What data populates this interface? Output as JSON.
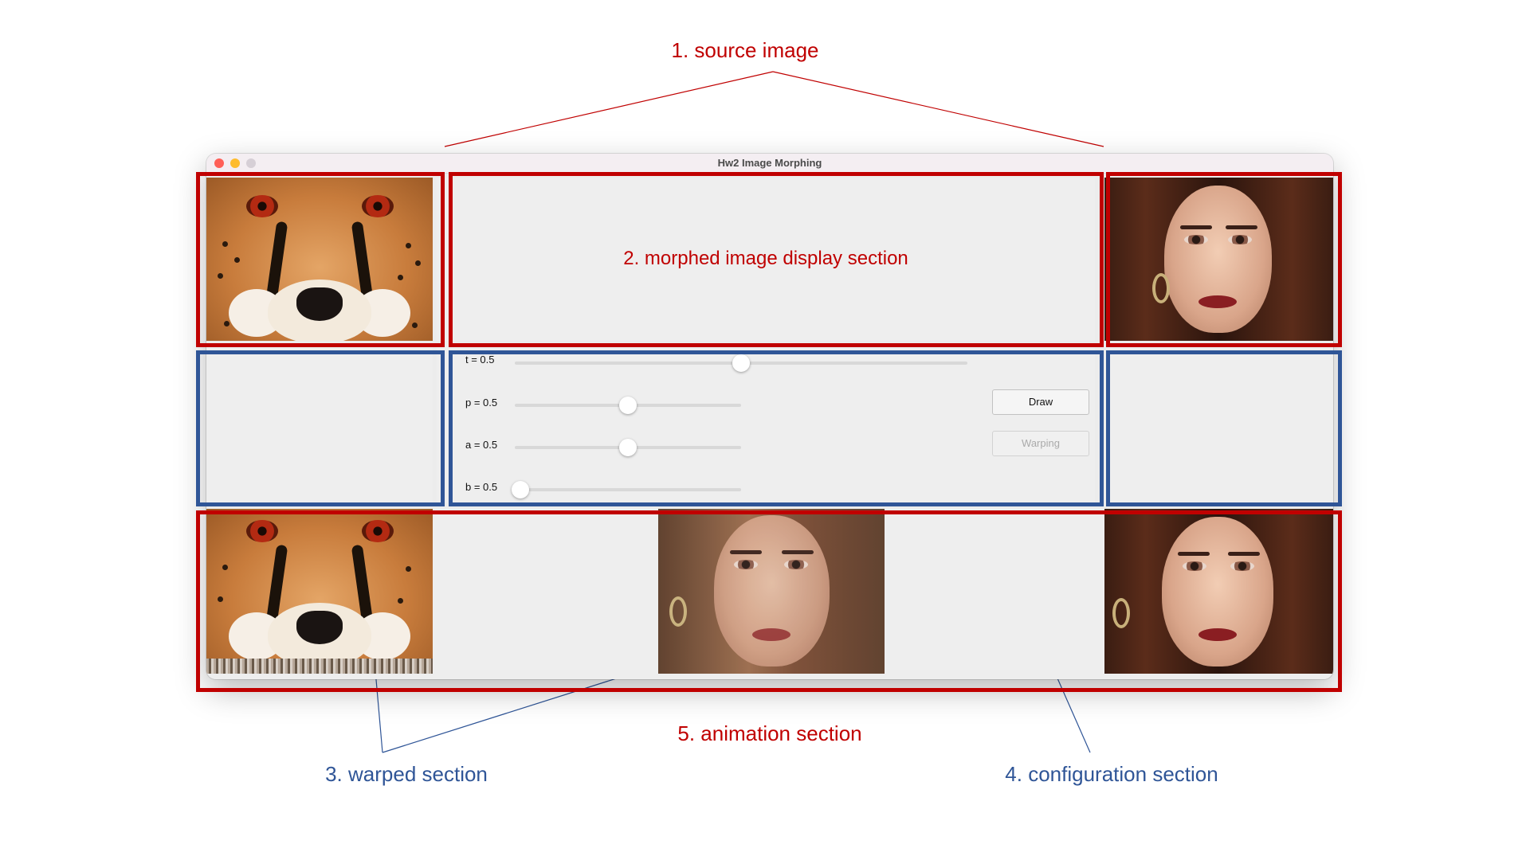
{
  "annotations": {
    "source_image": "1. source image",
    "morphed_display": "2. morphed image display section",
    "warped": "3. warped section",
    "configuration": "4. configuration section",
    "animation": "5. animation section"
  },
  "window": {
    "title": "Hw2 Image Morphing"
  },
  "config": {
    "sliders": [
      {
        "label": "t = 0.5",
        "value": 0.5
      },
      {
        "label": "p = 0.5",
        "value": 0.5
      },
      {
        "label": "a = 0.5",
        "value": 0.5
      },
      {
        "label": "b = 0.5",
        "value": 0.0
      }
    ],
    "draw_button": "Draw",
    "warping_button": "Warping"
  },
  "colors": {
    "red_annotation": "#c00000",
    "blue_annotation": "#2f5597"
  }
}
